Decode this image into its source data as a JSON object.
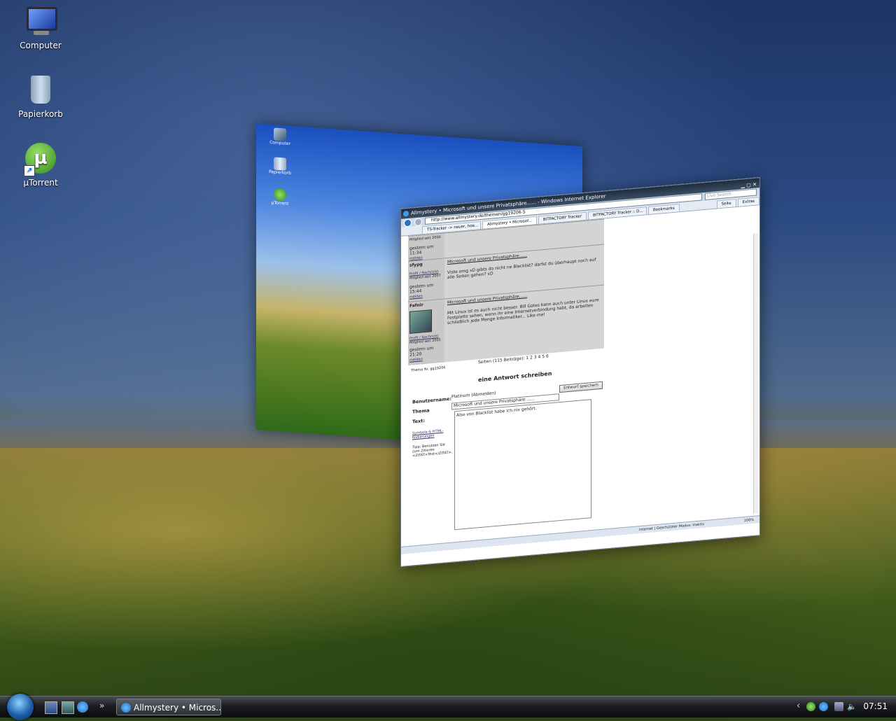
{
  "desktop": {
    "icons": [
      {
        "label": "Computer"
      },
      {
        "label": "Papierkorb"
      },
      {
        "label": "µTorrent"
      }
    ]
  },
  "back_window": {
    "icons": [
      {
        "label": "Computer"
      },
      {
        "label": "Papierkorb"
      },
      {
        "label": "µTorrent"
      }
    ]
  },
  "ie": {
    "title": "Allmystery • Microsoft und unsere Privatsphäre...... - Windows Internet Explorer",
    "address": "http://www.allmystery.de/themen/gg19206-5",
    "search_placeholder": "Live Search",
    "tabs": [
      {
        "label": "TS-Tracker -> neuer, hoe..."
      },
      {
        "label": "Allmystery • Microsof...",
        "active": true
      },
      {
        "label": "BITFACTORY Tracker"
      },
      {
        "label": "BITFACTORY Tracker :: D..."
      },
      {
        "label": "Bookmarks"
      }
    ],
    "toolbar": {
      "page_label": "Seite",
      "extras_label": "Extras"
    },
    "posts": [
      {
        "username": "",
        "member_since": "Mitglied seit 2006",
        "time": "gestern um 11:34",
        "report": "melden",
        "subject": "",
        "text": ""
      },
      {
        "username": "sfypg",
        "links": "Profil / Nachricht",
        "member_since": "Mitglied seit 2007",
        "time": "gestern um 15:44",
        "report": "melden",
        "subject": "Microsoft und unsere Privatsphäre......",
        "text": "Viste omg xD gibts do nicht ne Blacklist? darfst du überhaupt noch auf alle Seiten gehen? xD"
      },
      {
        "username": "Fafnir",
        "links": "Profil / Nachricht",
        "member_since": "Mitglied seit 2005",
        "time": "gestern um 21:20",
        "report": "melden",
        "subject": "Microsoft und unsere Privatsphäre......",
        "text": "Mit Linux ist es auch nicht besser. Bill Gates kann auch unter Linux eure Festplatte sehen, wenn ihr eine Internetverbindung habt, da arbeiten schließlich jede Menge Informatiker... Like me!"
      }
    ],
    "thema_nr": "Thema Nr. gg19206",
    "pages": "Seiten (115 Beiträge): 1 2 3 4 5 6",
    "reply_heading": "eine Antwort schreiben",
    "form": {
      "username_label": "Benutzername:",
      "username_value": "Platinum (Abmelden)",
      "save_draft": "Entwurf speichern",
      "thema_label": "Thema",
      "thema_value": "Microsoft und unsere Privatsphäre ......",
      "text_label": "Text:",
      "text_value": "Also von Blacklist habe ich nix gehört.",
      "symbols_link": "Symbole & HTML-Kodierungen",
      "tips": "Tipp: Benutzen Sie zum Zitieren <ZITAT>Text</ZITAT>."
    },
    "status": {
      "zone": "Internet | Geschützter Modus: Inaktiv",
      "zoom": "100%"
    }
  },
  "taskbar": {
    "more": "»",
    "task_label": "Allmystery • Micros...",
    "clock": "07:51"
  }
}
